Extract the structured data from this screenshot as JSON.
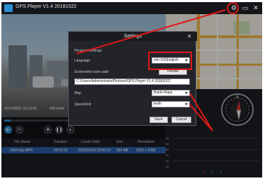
{
  "app": {
    "title": "GPS Player V1.4 20181022"
  },
  "video": {
    "timestamp": "2017/06/01 16:23:09",
    "speed": "000 km/h"
  },
  "playback": {
    "progress": 0.04
  },
  "file_table": {
    "headers": [
      "File Name",
      "Duration",
      "Create Date",
      "Size",
      "Resolution"
    ],
    "rows": [
      [
        "0264 day.MP4",
        "00:01:03",
        "2018/10/30 19:56:10",
        "284 MB",
        "1920 x 1080"
      ]
    ]
  },
  "graph": {
    "y_ticks": [
      "50",
      "00",
      "50",
      "00",
      "50",
      "00"
    ],
    "legend": [
      "X",
      "Y",
      "Z"
    ]
  },
  "settings": {
    "title": "Settings",
    "personal_settings": "Personal settings",
    "language_label": "Language",
    "language_value": "zen-US(English",
    "screenshot_label": "Screenshot save path",
    "choose_label": "choose",
    "save_path": "C:/Users/Administrator/Pictures/GPS Player V1.4 20181022",
    "map_label": "Map",
    "map_value": "Baidu Maps",
    "speed_label": "SpeedUnit",
    "speed_value": "km/h",
    "save_label": "Save",
    "cancel_label": "Cancel"
  },
  "compass": {
    "north": "N"
  },
  "colors": {
    "accent": "#2a8fd6",
    "highlight": "#e01818",
    "selected_row": "#2a5fa8"
  },
  "icons": [
    "gear-icon",
    "minimize-icon",
    "close-icon",
    "play-icon",
    "stop-icon",
    "snapshot-icon",
    "compass-icon"
  ]
}
